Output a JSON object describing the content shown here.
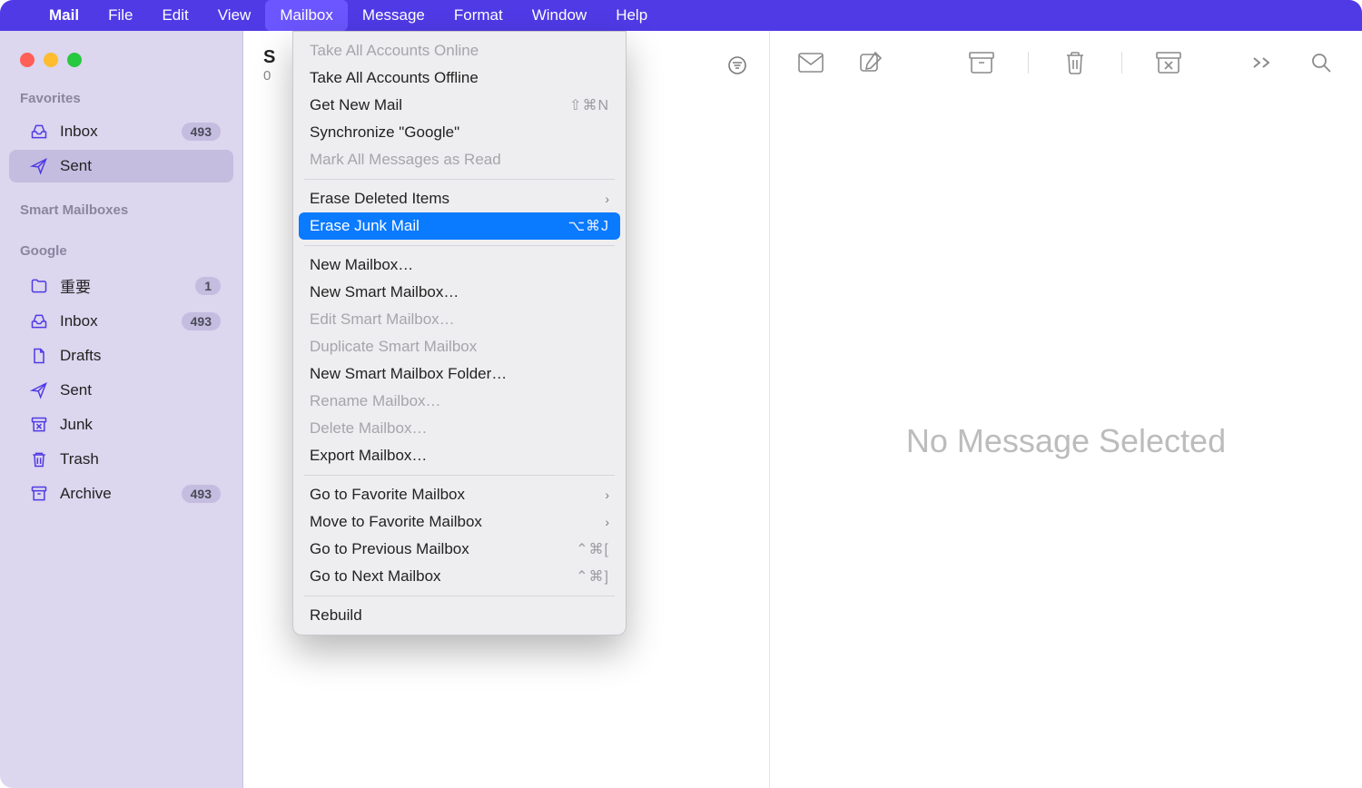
{
  "menubar": {
    "app": "Mail",
    "items": [
      "File",
      "Edit",
      "View",
      "Mailbox",
      "Message",
      "Format",
      "Window",
      "Help"
    ],
    "active_index": 3
  },
  "sidebar": {
    "sections": [
      {
        "label": "Favorites",
        "items": [
          {
            "name": "Inbox",
            "icon": "inbox",
            "badge": "493",
            "selected": false
          },
          {
            "name": "Sent",
            "icon": "sent",
            "badge": "",
            "selected": true
          }
        ]
      },
      {
        "label": "Smart Mailboxes",
        "items": []
      },
      {
        "label": "Google",
        "items": [
          {
            "name": "重要",
            "icon": "folder",
            "badge": "1",
            "selected": false
          },
          {
            "name": "Inbox",
            "icon": "inbox",
            "badge": "493",
            "selected": false
          },
          {
            "name": "Drafts",
            "icon": "drafts",
            "badge": "",
            "selected": false
          },
          {
            "name": "Sent",
            "icon": "sent",
            "badge": "",
            "selected": false
          },
          {
            "name": "Junk",
            "icon": "junk",
            "badge": "",
            "selected": false
          },
          {
            "name": "Trash",
            "icon": "trash",
            "badge": "",
            "selected": false
          },
          {
            "name": "Archive",
            "icon": "archive",
            "badge": "493",
            "selected": false
          }
        ]
      }
    ]
  },
  "list": {
    "title_first_char": "S",
    "sub_first_char": "0"
  },
  "message_pane": {
    "empty_text": "No Message Selected"
  },
  "dropdown": {
    "groups": [
      [
        {
          "label": "Take All Accounts Online",
          "disabled": true
        },
        {
          "label": "Take All Accounts Offline",
          "disabled": false
        },
        {
          "label": "Get New Mail",
          "shortcut": "⇧⌘N",
          "disabled": false
        },
        {
          "label": "Synchronize \"Google\"",
          "disabled": false
        },
        {
          "label": "Mark All Messages as Read",
          "disabled": true
        }
      ],
      [
        {
          "label": "Erase Deleted Items",
          "submenu": true,
          "disabled": false
        },
        {
          "label": "Erase Junk Mail",
          "shortcut": "⌥⌘J",
          "highlight": true,
          "disabled": false
        }
      ],
      [
        {
          "label": "New Mailbox…",
          "disabled": false
        },
        {
          "label": "New Smart Mailbox…",
          "disabled": false
        },
        {
          "label": "Edit Smart Mailbox…",
          "disabled": true
        },
        {
          "label": "Duplicate Smart Mailbox",
          "disabled": true
        },
        {
          "label": "New Smart Mailbox Folder…",
          "disabled": false
        },
        {
          "label": "Rename Mailbox…",
          "disabled": true
        },
        {
          "label": "Delete Mailbox…",
          "disabled": true
        },
        {
          "label": "Export Mailbox…",
          "disabled": false
        }
      ],
      [
        {
          "label": "Go to Favorite Mailbox",
          "submenu": true,
          "disabled": false
        },
        {
          "label": "Move to Favorite Mailbox",
          "submenu": true,
          "disabled": false
        },
        {
          "label": "Go to Previous Mailbox",
          "shortcut": "⌃⌘[",
          "disabled": false
        },
        {
          "label": "Go to Next Mailbox",
          "shortcut": "⌃⌘]",
          "disabled": false
        }
      ],
      [
        {
          "label": "Rebuild",
          "disabled": false
        }
      ]
    ]
  }
}
